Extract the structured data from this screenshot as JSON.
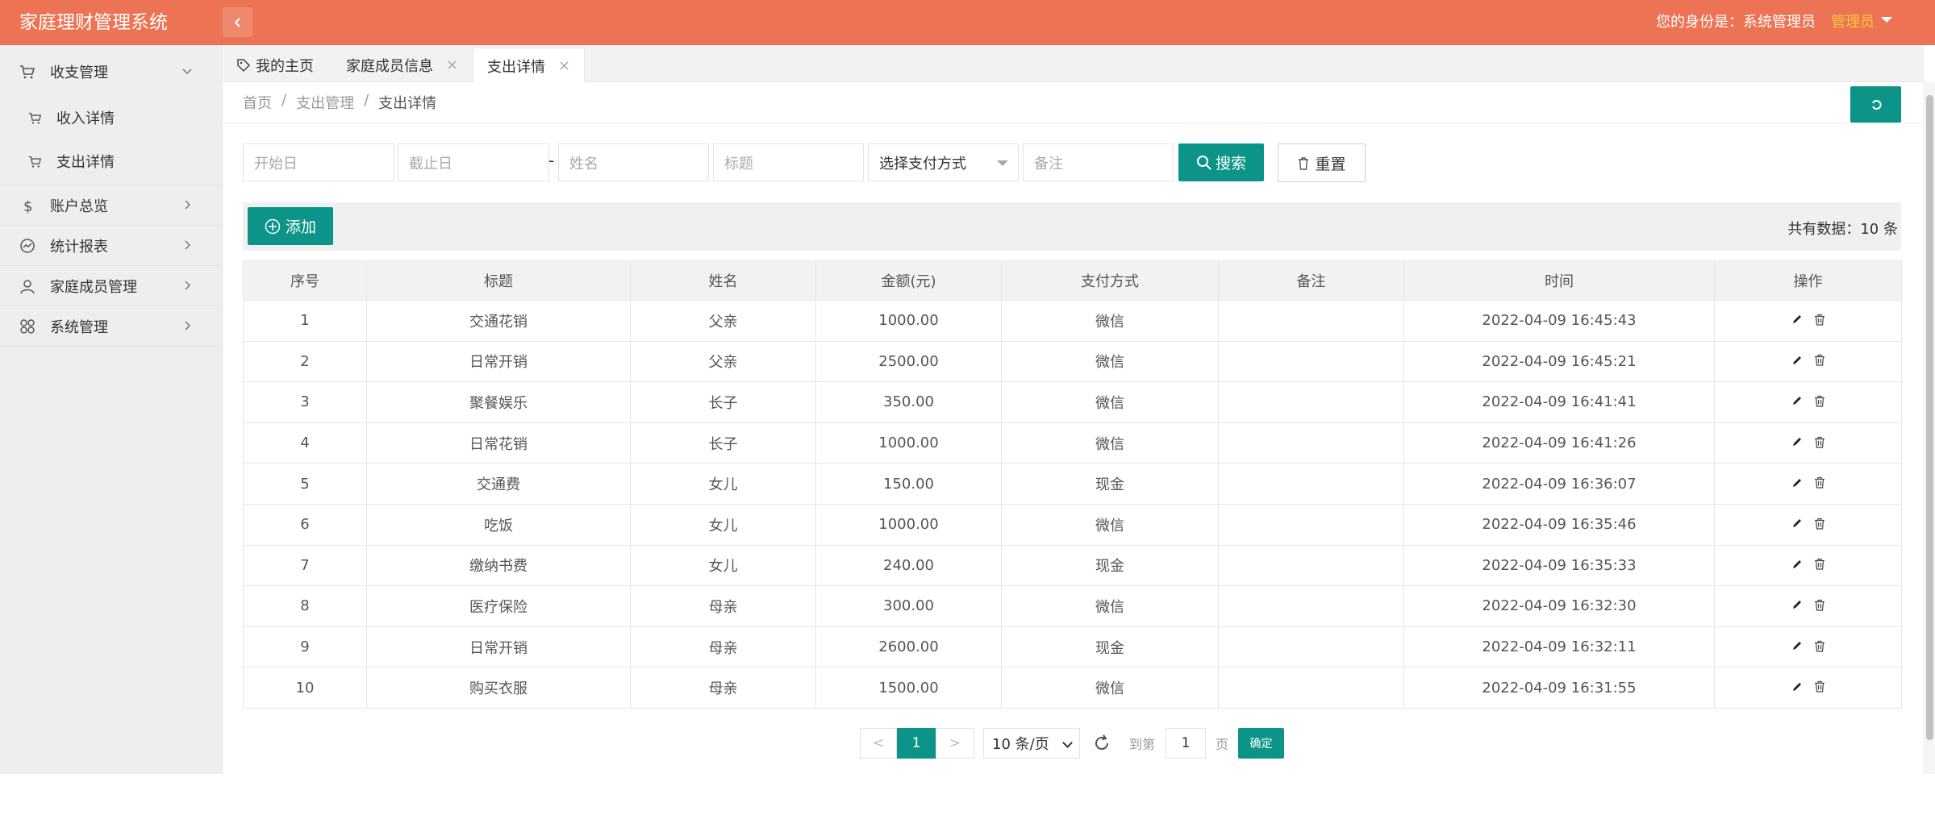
{
  "header": {
    "app_title": "家庭理财管理系统",
    "identity": "您的身份是：系统管理员",
    "user_label": "管理员"
  },
  "sidebar": {
    "items": [
      {
        "label": "收支管理",
        "icon": "cart-icon"
      },
      {
        "label": "收入详情",
        "icon": "cart-icon"
      },
      {
        "label": "支出详情",
        "icon": "cart-icon"
      },
      {
        "label": "账户总览",
        "icon": "dollar-icon"
      },
      {
        "label": "统计报表",
        "icon": "chart-icon"
      },
      {
        "label": "家庭成员管理",
        "icon": "user-icon"
      },
      {
        "label": "系统管理",
        "icon": "apps-icon"
      }
    ]
  },
  "tabs": [
    {
      "label": "我的主页"
    },
    {
      "label": "家庭成员信息"
    },
    {
      "label": "支出详情"
    }
  ],
  "breadcrumb": {
    "home": "首页",
    "section": "支出管理",
    "current": "支出详情",
    "sep": "/"
  },
  "search": {
    "start_date_placeholder": "开始日",
    "end_date_placeholder": "截止日",
    "range_sep": "-",
    "name_placeholder": "姓名",
    "title_placeholder": "标题",
    "payment_select": "选择支付方式",
    "remark_placeholder": "备注",
    "search_label": "搜索",
    "reset_label": "重置"
  },
  "toolbar": {
    "add_label": "添加",
    "total": "共有数据：10 条"
  },
  "table": {
    "columns": [
      "序号",
      "标题",
      "姓名",
      "金额(元)",
      "支付方式",
      "备注",
      "时间",
      "操作"
    ],
    "rows": [
      [
        "1",
        "交通花销",
        "父亲",
        "1000.00",
        "微信",
        "",
        "2022-04-09 16:45:43"
      ],
      [
        "2",
        "日常开销",
        "父亲",
        "2500.00",
        "微信",
        "",
        "2022-04-09 16:45:21"
      ],
      [
        "3",
        "聚餐娱乐",
        "长子",
        "350.00",
        "微信",
        "",
        "2022-04-09 16:41:41"
      ],
      [
        "4",
        "日常花销",
        "长子",
        "1000.00",
        "微信",
        "",
        "2022-04-09 16:41:26"
      ],
      [
        "5",
        "交通费",
        "女儿",
        "150.00",
        "现金",
        "",
        "2022-04-09 16:36:07"
      ],
      [
        "6",
        "吃饭",
        "女儿",
        "1000.00",
        "微信",
        "",
        "2022-04-09 16:35:46"
      ],
      [
        "7",
        "缴纳书费",
        "女儿",
        "240.00",
        "现金",
        "",
        "2022-04-09 16:35:33"
      ],
      [
        "8",
        "医疗保险",
        "母亲",
        "300.00",
        "微信",
        "",
        "2022-04-09 16:32:30"
      ],
      [
        "9",
        "日常开销",
        "母亲",
        "2600.00",
        "现金",
        "",
        "2022-04-09 16:32:11"
      ],
      [
        "10",
        "购买衣服",
        "母亲",
        "1500.00",
        "微信",
        "",
        "2022-04-09 16:31:55"
      ]
    ]
  },
  "pagination": {
    "prev": "<",
    "current": "1",
    "next": ">",
    "page_size": "10 条/页",
    "goto_label": "到第",
    "goto_value": "1",
    "page_unit": "页",
    "confirm_label": "确定"
  },
  "colors": {
    "header": "#ec7353",
    "accent": "#0d9488",
    "user_label": "#ffc83a"
  }
}
